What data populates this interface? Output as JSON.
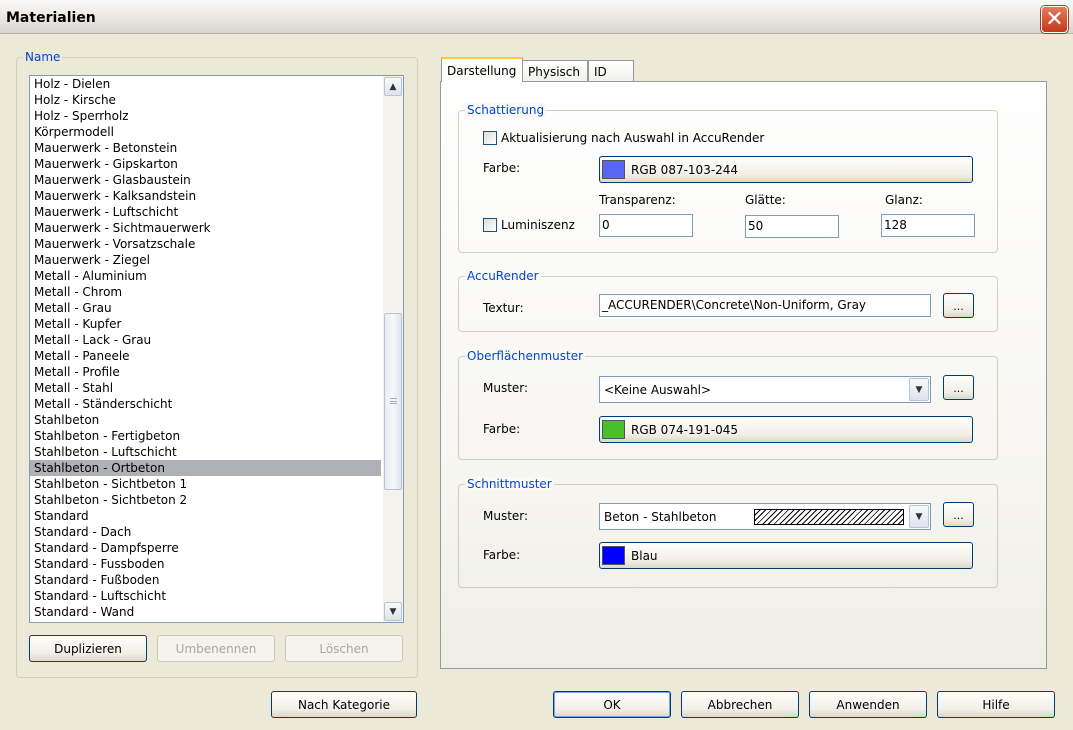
{
  "window": {
    "title": "Materialien",
    "close_glyph": "✕"
  },
  "name_group": {
    "label": "Name",
    "items": [
      "Holz - Dielen",
      "Holz - Kirsche",
      "Holz - Sperrholz",
      "Körpermodell",
      "Mauerwerk - Betonstein",
      "Mauerwerk - Gipskarton",
      "Mauerwerk - Glasbaustein",
      "Mauerwerk - Kalksandstein",
      "Mauerwerk - Luftschicht",
      "Mauerwerk - Sichtmauerwerk",
      "Mauerwerk - Vorsatzschale",
      "Mauerwerk - Ziegel",
      "Metall - Aluminium",
      "Metall - Chrom",
      "Metall - Grau",
      "Metall - Kupfer",
      "Metall - Lack - Grau",
      "Metall - Paneele",
      "Metall - Profile",
      "Metall - Stahl",
      "Metall - Ständerschicht",
      "Stahlbeton",
      "Stahlbeton - Fertigbeton",
      "Stahlbeton - Luftschicht",
      "Stahlbeton - Ortbeton",
      "Stahlbeton - Sichtbeton 1",
      "Stahlbeton - Sichtbeton 2",
      "Standard",
      "Standard - Dach",
      "Standard - Dampfsperre",
      "Standard - Fussboden",
      "Standard - Fußboden",
      "Standard - Luftschicht",
      "Standard - Wand"
    ],
    "selected_index": 24,
    "scrollbar": {
      "up_icon": "▲",
      "down_icon": "▼"
    },
    "buttons": {
      "duplicate": "Duplizieren",
      "rename": "Umbenennen",
      "delete": "Löschen"
    }
  },
  "tabs": [
    "Darstellung",
    "Physisch",
    "ID"
  ],
  "active_tab": 0,
  "shading": {
    "label": "Schattierung",
    "update_checkbox_label": "Aktualisierung nach Auswahl in AccuRender",
    "color_label": "Farbe:",
    "color_text": "RGB 087-103-244",
    "color_hex": "#5767f4",
    "transparency_label": "Transparenz:",
    "smoothness_label": "Glätte:",
    "gloss_label": "Glanz:",
    "luminescence_label": "Luminiszenz",
    "transparency_value": "0",
    "smoothness_value": "50",
    "gloss_value": "128"
  },
  "accurender": {
    "label": "AccuRender",
    "texture_label": "Textur:",
    "texture_value": "_ACCURENDER\\Concrete\\Non-Uniform, Gray",
    "browse_label": "..."
  },
  "surface_pattern": {
    "label": "Oberflächenmuster",
    "pattern_label": "Muster:",
    "pattern_value": "<Keine Auswahl>",
    "browse_label": "...",
    "color_label": "Farbe:",
    "color_text": "RGB 074-191-045",
    "color_hex": "#4abf2d"
  },
  "section_pattern": {
    "label": "Schnittmuster",
    "pattern_label": "Muster:",
    "pattern_value": "Beton - Stahlbeton",
    "browse_label": "...",
    "color_label": "Farbe:",
    "color_text": "Blau",
    "color_hex": "#0000ff"
  },
  "footer": {
    "by_category": "Nach Kategorie",
    "ok": "OK",
    "cancel": "Abbrechen",
    "apply": "Anwenden",
    "help": "Hilfe"
  },
  "icons": {
    "dropdown_arrow": "▼"
  }
}
